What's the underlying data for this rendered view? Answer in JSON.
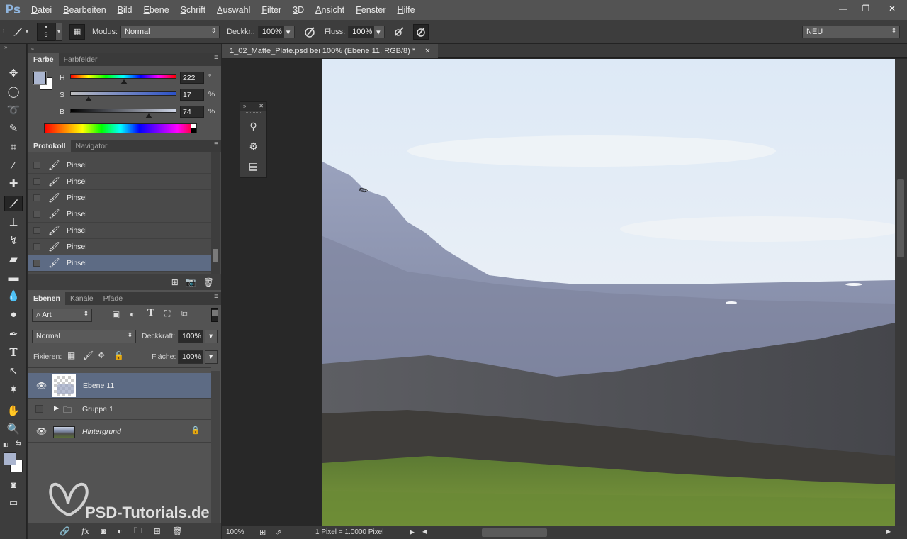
{
  "app": {
    "logo": "Ps"
  },
  "menu": [
    "Datei",
    "Bearbeiten",
    "Bild",
    "Ebene",
    "Schrift",
    "Auswahl",
    "Filter",
    "3D",
    "Ansicht",
    "Fenster",
    "Hilfe"
  ],
  "window_controls": {
    "minimize": "—",
    "restore": "❐",
    "close": "✕"
  },
  "options": {
    "brush_size": "9",
    "mode_label": "Modus:",
    "mode_value": "Normal",
    "opacity_label": "Deckkr.:",
    "opacity_value": "100%",
    "flow_label": "Fluss:",
    "flow_value": "100%",
    "workspace": "NEU"
  },
  "color_panel": {
    "tabs": [
      "Farbe",
      "Farbfelder"
    ],
    "h_label": "H",
    "h_value": "222",
    "h_unit": "°",
    "s_label": "S",
    "s_value": "17",
    "s_unit": "%",
    "b_label": "B",
    "b_value": "74",
    "b_unit": "%",
    "foreground": "#aab5cf",
    "background": "#ffffff"
  },
  "history_panel": {
    "tabs": [
      "Protokoll",
      "Navigator"
    ],
    "items": [
      "Pinsel",
      "Pinsel",
      "Pinsel",
      "Pinsel",
      "Pinsel",
      "Pinsel",
      "Pinsel"
    ],
    "active_index": 6
  },
  "layers_panel": {
    "tabs": [
      "Ebenen",
      "Kanäle",
      "Pfade"
    ],
    "filter_kind": "Art",
    "blend_mode": "Normal",
    "opacity_label": "Deckkraft:",
    "opacity_value": "100%",
    "lock_label": "Fixieren:",
    "fill_label": "Fläche:",
    "fill_value": "100%",
    "layers": [
      {
        "name": "Ebene 11",
        "visible": true,
        "active": true
      },
      {
        "name": "Gruppe 1",
        "visible": false,
        "active": false
      },
      {
        "name": "Hintergrund",
        "visible": true,
        "active": false,
        "locked": true
      }
    ]
  },
  "document": {
    "tab_title": "1_02_Matte_Plate.psd bei 100% (Ebene 11, RGB/8) *",
    "zoom": "100%",
    "status": "1 Pixel = 1.0000 Pixel"
  },
  "watermark": "PSD-Tutorials.de"
}
